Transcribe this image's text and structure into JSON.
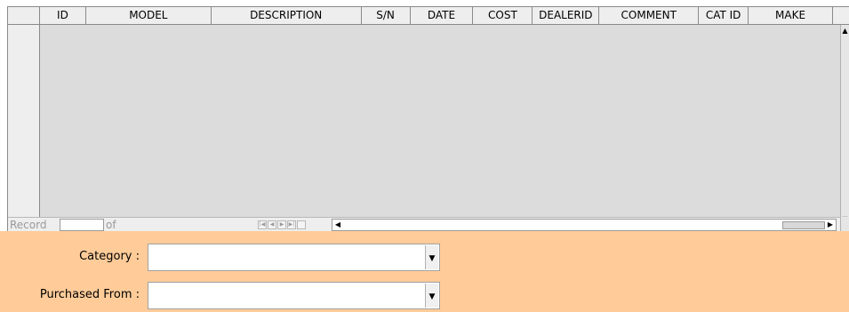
{
  "grid": {
    "columns": [
      {
        "label": "ID"
      },
      {
        "label": "MODEL"
      },
      {
        "label": "DESCRIPTION"
      },
      {
        "label": "S/N"
      },
      {
        "label": "DATE"
      },
      {
        "label": "COST"
      },
      {
        "label": "DEALERID"
      },
      {
        "label": "COMMENT"
      },
      {
        "label": "CAT ID"
      },
      {
        "label": "MAKE"
      }
    ],
    "rows": []
  },
  "navigator": {
    "record_label": "Record",
    "record_value": "",
    "of_label": "of"
  },
  "form": {
    "category_label": "Category :",
    "category_value": "",
    "purchased_from_label": "Purchased From :",
    "purchased_from_value": ""
  },
  "colors": {
    "form_background": "#ffcc99",
    "grid_background": "#dcdcdc"
  }
}
